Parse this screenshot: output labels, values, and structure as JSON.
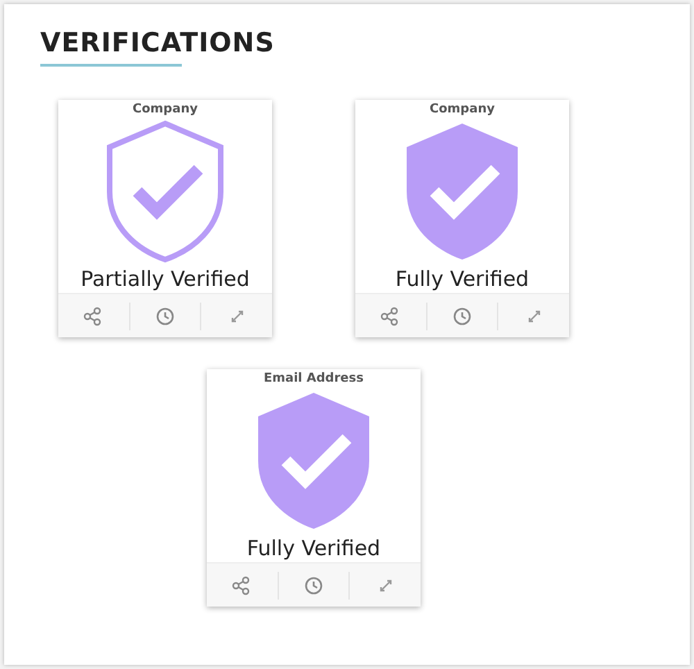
{
  "section": {
    "title": "VERIFICATIONS"
  },
  "cards": [
    {
      "label": "Company",
      "kind": "partial",
      "status": "Partially Verified"
    },
    {
      "label": "Company",
      "kind": "full",
      "status": "Fully Verified"
    },
    {
      "label": "Email Address",
      "kind": "full",
      "status": "Fully Verified"
    }
  ]
}
